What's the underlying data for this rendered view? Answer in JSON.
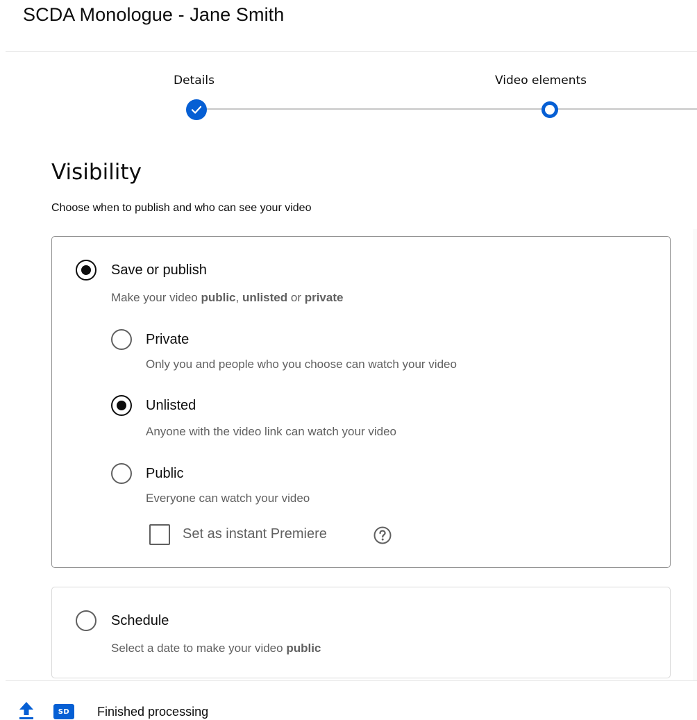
{
  "dialog": {
    "title": "SCDA Monologue - Jane Smith"
  },
  "stepper": {
    "steps": [
      {
        "label": "Details",
        "state": "completed"
      },
      {
        "label": "Video elements",
        "state": "current"
      }
    ]
  },
  "visibility": {
    "title": "Visibility",
    "subtitle": "Choose when to publish and who can see your video",
    "save_or_publish": {
      "label": "Save or publish",
      "selected": true,
      "desc_prefix": "Make your video ",
      "desc_public": "public",
      "desc_sep1": ", ",
      "desc_unlisted": "unlisted",
      "desc_sep2": " or ",
      "desc_private": "private",
      "options": [
        {
          "label": "Private",
          "desc": "Only you and people who you choose can watch your video",
          "selected": false
        },
        {
          "label": "Unlisted",
          "desc": "Anyone with the video link can watch your video",
          "selected": true
        },
        {
          "label": "Public",
          "desc": "Everyone can watch your video",
          "selected": false
        }
      ],
      "premiere": {
        "label": "Set as instant Premiere",
        "checked": false
      }
    },
    "schedule": {
      "label": "Schedule",
      "selected": false,
      "desc_prefix": "Select a date to make your video ",
      "desc_bold": "public"
    }
  },
  "footer": {
    "quality_badge": "SD",
    "status": "Finished processing"
  },
  "colors": {
    "accent": "#065fd4",
    "text": "#0d0d0d",
    "secondary_text": "#606060"
  },
  "icons": [
    "check-icon",
    "help-icon",
    "upload-icon"
  ]
}
